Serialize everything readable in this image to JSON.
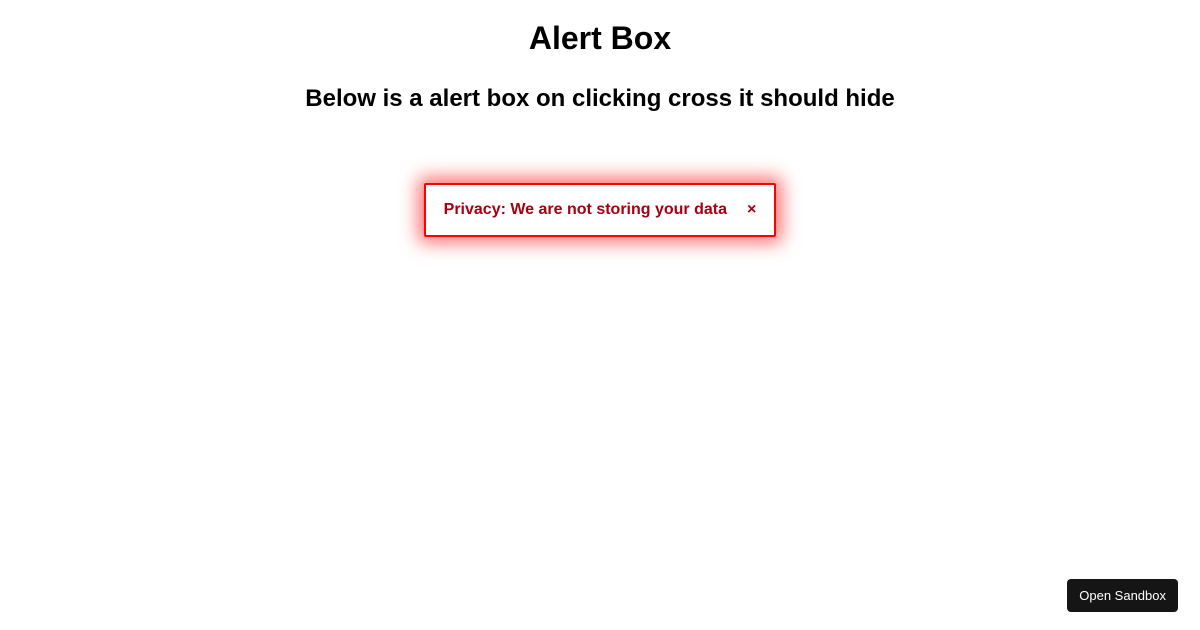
{
  "header": {
    "title": "Alert Box",
    "subtitle": "Below is a alert box on clicking cross it should hide"
  },
  "alert": {
    "message": "Privacy: We are not storing your data",
    "close_symbol": "×",
    "border_color": "#ff0000",
    "text_color": "#a40010"
  },
  "footer": {
    "open_sandbox_label": "Open Sandbox"
  }
}
